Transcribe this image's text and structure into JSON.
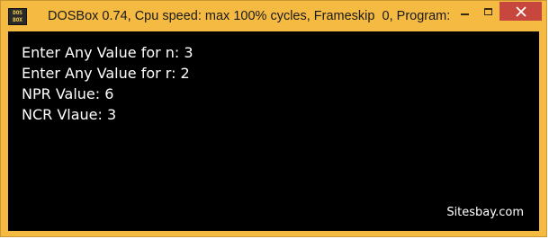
{
  "window": {
    "title": "DOSBox 0.74, Cpu speed: max 100% cycles, Frameskip  0, Program:",
    "app_icon": {
      "name": "dosbox-icon",
      "line1": "DOS",
      "line2": "BOX"
    },
    "controls": {
      "minimize_icon": "minimize-icon",
      "maximize_icon": "maximize-icon",
      "close_icon": "close-icon"
    },
    "colors": {
      "frame": "#f4ba41",
      "close_button": "#c7463d",
      "console_background": "#000000",
      "console_text": "#ffffff"
    }
  },
  "console": {
    "lines": [
      "Enter Any Value for n: 3",
      "Enter Any Value for r: 2",
      "NPR Value: 6",
      "NCR Vlaue: 3"
    ],
    "watermark": "Sitesbay.com"
  }
}
